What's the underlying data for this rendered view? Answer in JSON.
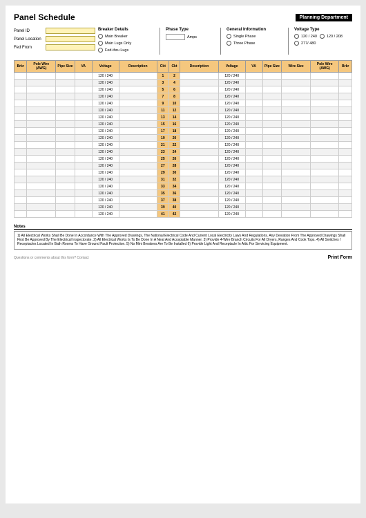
{
  "title": "Panel Schedule",
  "dept": "Planning Department",
  "form": {
    "panel_id_label": "Panel ID",
    "panel_location_label": "Panel Location",
    "fed_from_label": "Fed From"
  },
  "breaker": {
    "heading": "Breaker Details",
    "main_breaker": "Main Breaker",
    "main_lugs": "Main Lugs Only",
    "fed_thru": "Fed-thru Lugs",
    "amps_label": "Amps"
  },
  "phase": {
    "heading": "Phase Type",
    "single": "Single Phase",
    "three": "Three Phase"
  },
  "general": {
    "heading": "General Information"
  },
  "voltage_type": {
    "heading": "Voltage Type",
    "opt1": "120 / 240",
    "opt2": "120 / 208",
    "opt3": "277/ 480"
  },
  "columns": {
    "brkr": "Brkr",
    "pole_wire": "Pole Wire (AWG)",
    "pipe": "Pipe Size",
    "va": "VA",
    "voltage": "Voltage",
    "description": "Description",
    "ckt": "Ckt",
    "wire": "Wire Size"
  },
  "row_voltage": "120 / 240",
  "circuits_left": [
    1,
    3,
    5,
    7,
    9,
    11,
    13,
    15,
    17,
    19,
    21,
    23,
    25,
    27,
    29,
    31,
    33,
    35,
    37,
    39,
    41
  ],
  "circuits_right": [
    2,
    4,
    6,
    8,
    10,
    12,
    14,
    16,
    18,
    20,
    22,
    24,
    26,
    28,
    30,
    32,
    34,
    36,
    38,
    40,
    42
  ],
  "notes_heading": "Notes",
  "notes_text": "1) All Electrical Works Shall Be Done In Accordance With The Approved Drawings, The National Electrical Code And Current Local Electricity Laws And Regulations. Any Deviation From The Approved Drawings Shall First Be Approved By The Electrical Inspectorate.  2) All Electrical Works Is To Be Done In A Neat And Acceptable Manner.  3) Provide 4-Wire Branch Circuits For All Dryers, Ranges And Cook Tops.  4) All Switches / Receptacles Located In Bath Rooms To Have Ground Fault Protection.  5) No Mini Breakers Are To Be Installed  6) Provide Light And Receptacle In Attic For Servicing Equipment.",
  "footer_q": "Questions or comments about this form? Contact",
  "print": "Print Form"
}
